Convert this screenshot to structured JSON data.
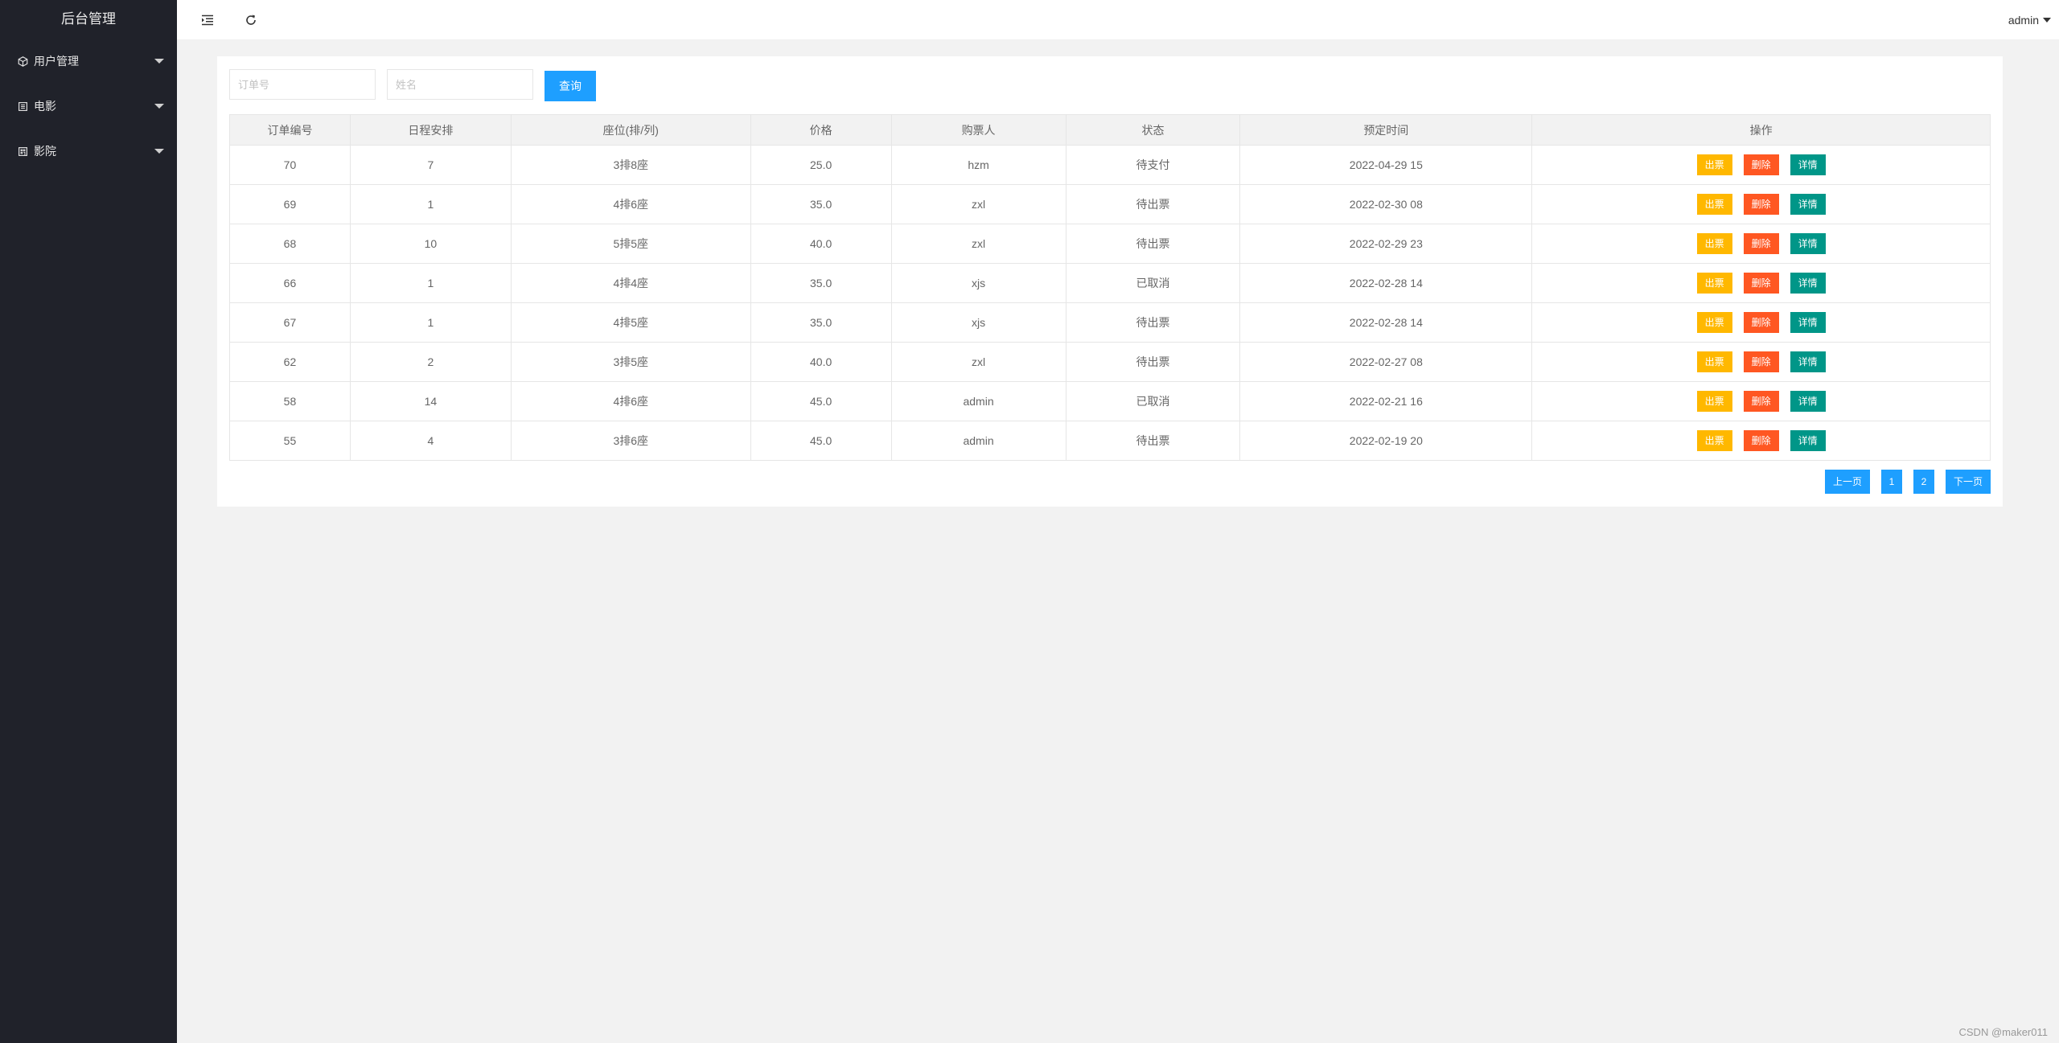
{
  "sidebar": {
    "title": "后台管理",
    "items": [
      {
        "label": "用户管理",
        "icon": "cube-icon"
      },
      {
        "label": "电影",
        "icon": "list-icon"
      },
      {
        "label": "影院",
        "icon": "building-icon"
      }
    ]
  },
  "header": {
    "user": "admin"
  },
  "search": {
    "order_placeholder": "订单号",
    "name_placeholder": "姓名",
    "button_label": "查询"
  },
  "table": {
    "headers": [
      "订单编号",
      "日程安排",
      "座位(排/列)",
      "价格",
      "购票人",
      "状态",
      "预定时间",
      "操作"
    ],
    "rows": [
      [
        "70",
        "7",
        "3排8座",
        "25.0",
        "hzm",
        "待支付",
        "2022-04-29 15"
      ],
      [
        "69",
        "1",
        "4排6座",
        "35.0",
        "zxl",
        "待出票",
        "2022-02-30 08"
      ],
      [
        "68",
        "10",
        "5排5座",
        "40.0",
        "zxl",
        "待出票",
        "2022-02-29 23"
      ],
      [
        "66",
        "1",
        "4排4座",
        "35.0",
        "xjs",
        "已取消",
        "2022-02-28 14"
      ],
      [
        "67",
        "1",
        "4排5座",
        "35.0",
        "xjs",
        "待出票",
        "2022-02-28 14"
      ],
      [
        "62",
        "2",
        "3排5座",
        "40.0",
        "zxl",
        "待出票",
        "2022-02-27 08"
      ],
      [
        "58",
        "14",
        "4排6座",
        "45.0",
        "admin",
        "已取消",
        "2022-02-21 16"
      ],
      [
        "55",
        "4",
        "3排6座",
        "45.0",
        "admin",
        "待出票",
        "2022-02-19 20"
      ]
    ],
    "actions": {
      "issue": "出票",
      "delete": "删除",
      "detail": "详情"
    }
  },
  "pagination": {
    "prev": "上一页",
    "pages": [
      "1",
      "2"
    ],
    "next": "下一页"
  },
  "watermark": "CSDN @maker011",
  "colors": {
    "sidebar_bg": "#20222a",
    "primary": "#1e9fff",
    "warm": "#ffb800",
    "danger": "#ff5722",
    "teal": "#009688"
  }
}
